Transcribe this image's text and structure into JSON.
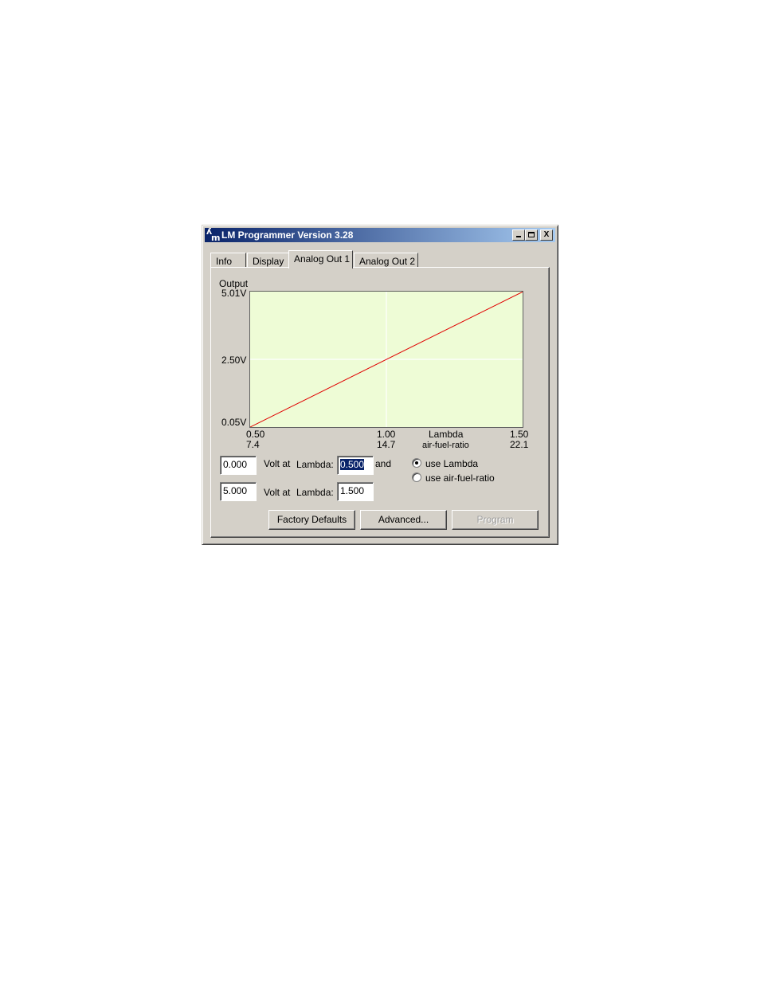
{
  "window": {
    "title": "LM Programmer Version 3.28",
    "controls": {
      "minimize": "_",
      "maximize": "□",
      "close": "X"
    }
  },
  "tabs": [
    "Info",
    "Display",
    "Analog Out 1",
    "Analog Out 2"
  ],
  "active_tab": "Analog Out 1",
  "chart_data": {
    "type": "line",
    "ylabel": "Output",
    "y_ticks": [
      "5.01V",
      "2.50V",
      "0.05V"
    ],
    "x_ticks_lambda": [
      "0.50",
      "1.00",
      "1.50"
    ],
    "x_ticks_afr": [
      "7.4",
      "14.7",
      "22.1"
    ],
    "x_axis_label_1": "Lambda",
    "x_axis_label_2": "air-fuel-ratio",
    "xlim": [
      0.5,
      1.5
    ],
    "ylim": [
      0.05,
      5.01
    ],
    "x": [
      0.5,
      1.5
    ],
    "y": [
      0.0,
      5.0
    ],
    "grid": true,
    "colors": {
      "plot_background": "#eefcd6",
      "line": "#e00000",
      "grid": "#ffffff"
    }
  },
  "settings": {
    "row1": {
      "volt": "0.000",
      "volt_at_label": "Volt at",
      "lambda_label": "Lambda:",
      "lambda_value": "0.500",
      "and_label": "and"
    },
    "row2": {
      "volt": "5.000",
      "volt_at_label": "Volt at",
      "lambda_label": "Lambda:",
      "lambda_value": "1.500"
    },
    "mode": {
      "use_lambda": "use Lambda",
      "use_afr": "use air-fuel-ratio",
      "selected": "use Lambda"
    }
  },
  "buttons": {
    "factory_defaults": "Factory Defaults",
    "advanced": "Advanced...",
    "program": "Program"
  }
}
